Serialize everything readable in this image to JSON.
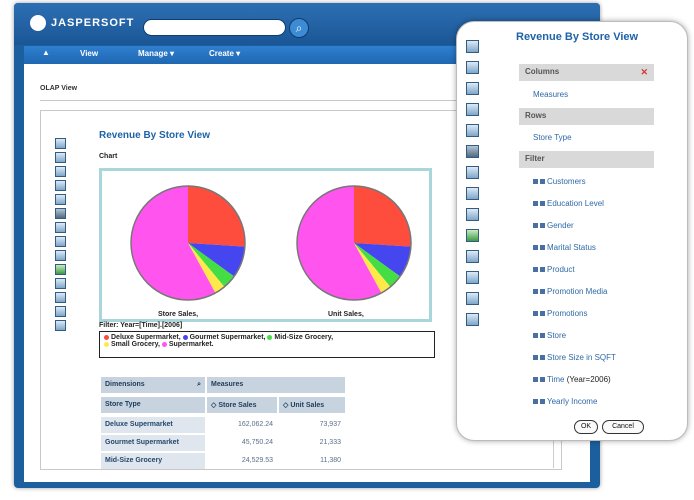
{
  "app": {
    "logo": "JASPERSOFT",
    "menu": [
      "View",
      "Manage ▾",
      "Create ▾"
    ],
    "tab": "OLAP View"
  },
  "view": {
    "title": "Revenue By Store View",
    "chart_label": "Chart",
    "filters_text": "Filter: Year=[Time].[2006]",
    "legend": [
      {
        "label": "Deluxe Supermarket,",
        "color": "#ff4d3d"
      },
      {
        "label": "Gourmet Supermarket,",
        "color": "#4646f0"
      },
      {
        "label": "Mid-Size Grocery,",
        "color": "#44dd44"
      },
      {
        "label": "Small Grocery,",
        "color": "#ffe94a"
      },
      {
        "label": "Supermarket.",
        "color": "#ff55ee"
      }
    ],
    "pie_labels": [
      "Store Sales,",
      "Unit Sales,"
    ]
  },
  "chart_data": {
    "type": "pie",
    "title": "",
    "categories": [
      "Deluxe Supermarket",
      "Gourmet Supermarket",
      "Mid-Size Grocery",
      "Small Grocery",
      "Supermarket"
    ],
    "series": [
      {
        "name": "Store Sales",
        "values": [
          0.26,
          0.09,
          0.04,
          0.03,
          0.58
        ]
      },
      {
        "name": "Unit Sales",
        "values": [
          0.26,
          0.09,
          0.04,
          0.03,
          0.58
        ]
      }
    ],
    "colors": [
      "#ff4d3d",
      "#4646f0",
      "#44dd44",
      "#ffe94a",
      "#ff55ee"
    ],
    "legend": "bottom"
  },
  "grid": {
    "dimensions_label": "Dimensions",
    "measures_label": "Measures",
    "store_type_label": "Store Type",
    "col_store_sales": "Store Sales",
    "col_unit_sales": "Unit Sales",
    "rows": [
      {
        "name": "Deluxe Supermarket",
        "store_sales": "162,062.24",
        "unit_sales": "73,937"
      },
      {
        "name": "Gourmet Supermarket",
        "store_sales": "45,750.24",
        "unit_sales": "21,333"
      },
      {
        "name": "Mid-Size Grocery",
        "store_sales": "24,529.53",
        "unit_sales": "11,380"
      }
    ]
  },
  "overlay": {
    "title": "Revenue By Store View",
    "columns_label": "Columns",
    "columns_item": "Measures",
    "rows_label": "Rows",
    "rows_item": "Store Type",
    "filter_label": "Filter",
    "filters": [
      "Customers",
      "Education Level",
      "Gender",
      "Marital Status",
      "Product",
      "Promotion Media",
      "Promotions",
      "Store",
      "Store Size in SQFT",
      "Time",
      "Yearly Income"
    ],
    "time_suffix": "(Year=2006)",
    "ok": "OK",
    "cancel": "Cancel"
  }
}
